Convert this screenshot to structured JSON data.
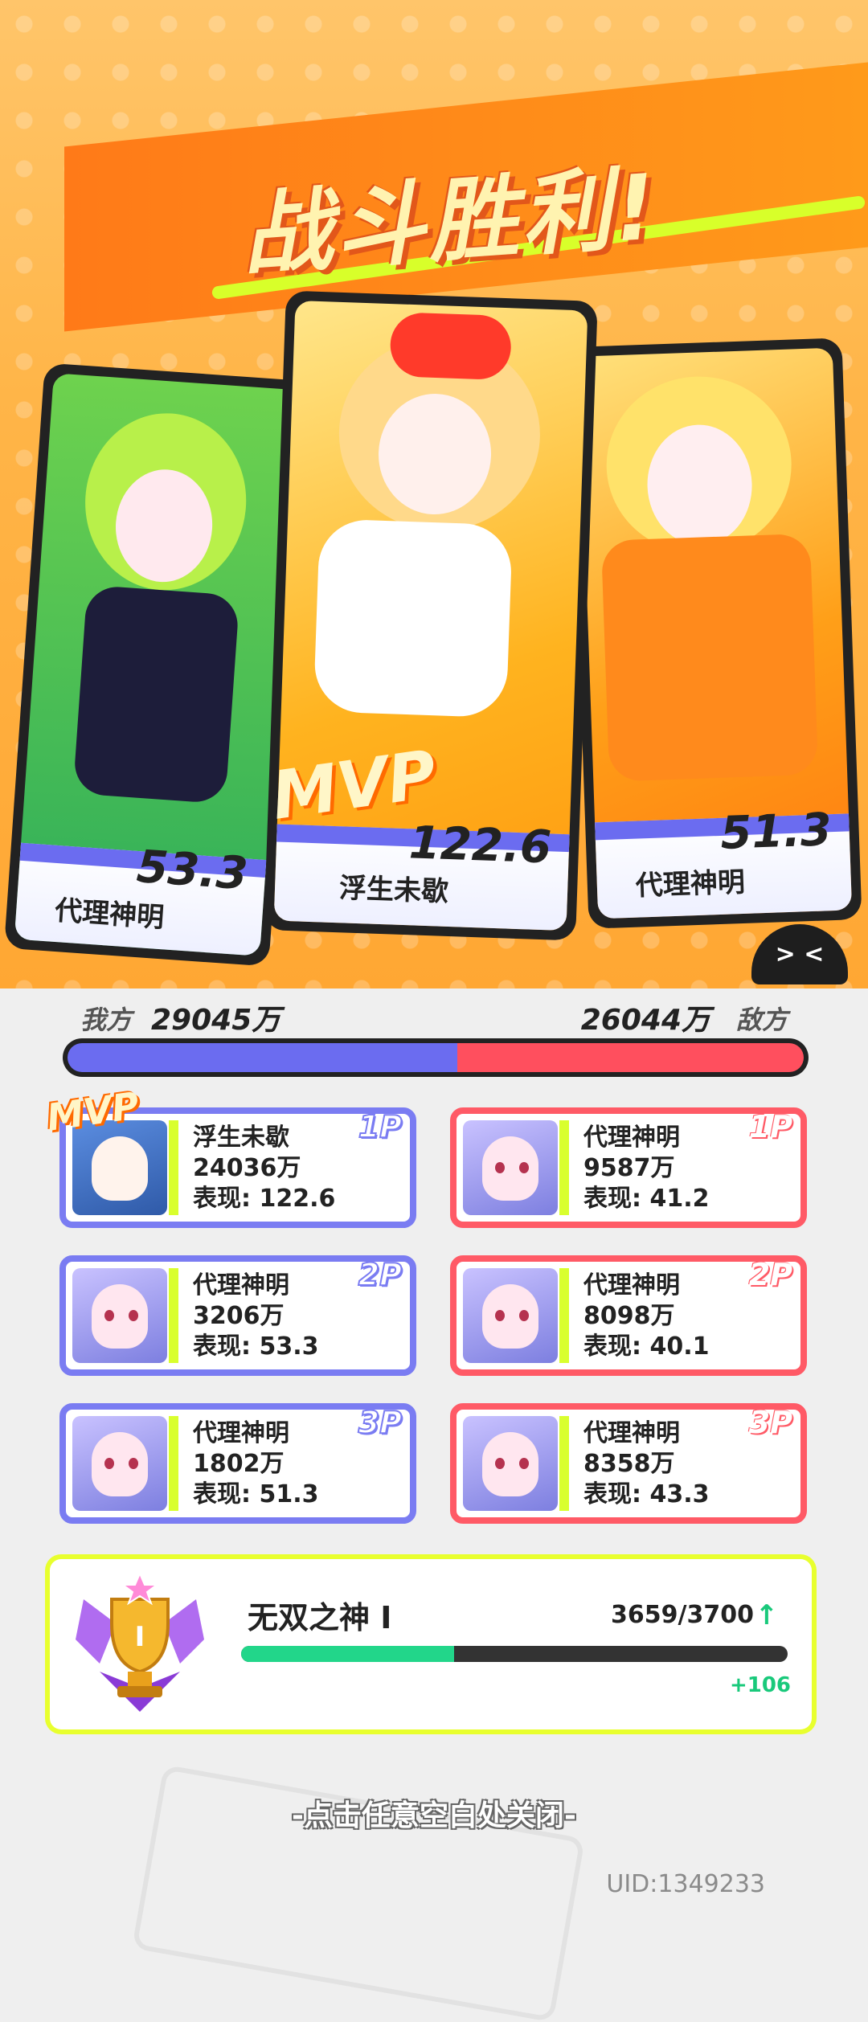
{
  "title": "战斗胜利!",
  "mvp_badge": "MVP",
  "featured_cards": [
    {
      "name": "代理神明",
      "score": "53.3"
    },
    {
      "name": "浮生未歇",
      "score": "122.6"
    },
    {
      "name": "代理神明",
      "score": "51.3"
    }
  ],
  "score_summary": {
    "my_label": "我方",
    "my_total": "29045万",
    "enemy_total": "26044万",
    "enemy_label": "敌方",
    "my_ratio": 0.53
  },
  "my_team": [
    {
      "rank": "1P",
      "name": "浮生未歇",
      "total": "24036万",
      "performance": "表现: 122.6",
      "mvp": true
    },
    {
      "rank": "2P",
      "name": "代理神明",
      "total": "3206万",
      "performance": "表现: 53.3"
    },
    {
      "rank": "3P",
      "name": "代理神明",
      "total": "1802万",
      "performance": "表现: 51.3"
    }
  ],
  "enemy_team": [
    {
      "rank": "1P",
      "name": "代理神明",
      "total": "9587万",
      "performance": "表现: 41.2"
    },
    {
      "rank": "2P",
      "name": "代理神明",
      "total": "8098万",
      "performance": "表现: 40.1"
    },
    {
      "rank": "3P",
      "name": "代理神明",
      "total": "8358万",
      "performance": "表现: 43.3"
    }
  ],
  "rank": {
    "title": "无双之神 I",
    "progress_text": "3659/3700",
    "progress_ratio": 0.39,
    "gain": "+106",
    "trophy_numeral": "I"
  },
  "close_hint": "-点击任意空白处关闭-",
  "uid": "UID:1349233",
  "blob_face": "> <",
  "colors": {
    "blue_team": "#7a7cf2",
    "red_team": "#ff5a66",
    "accent": "#d9ff2e",
    "progress_green": "#22d68a"
  }
}
